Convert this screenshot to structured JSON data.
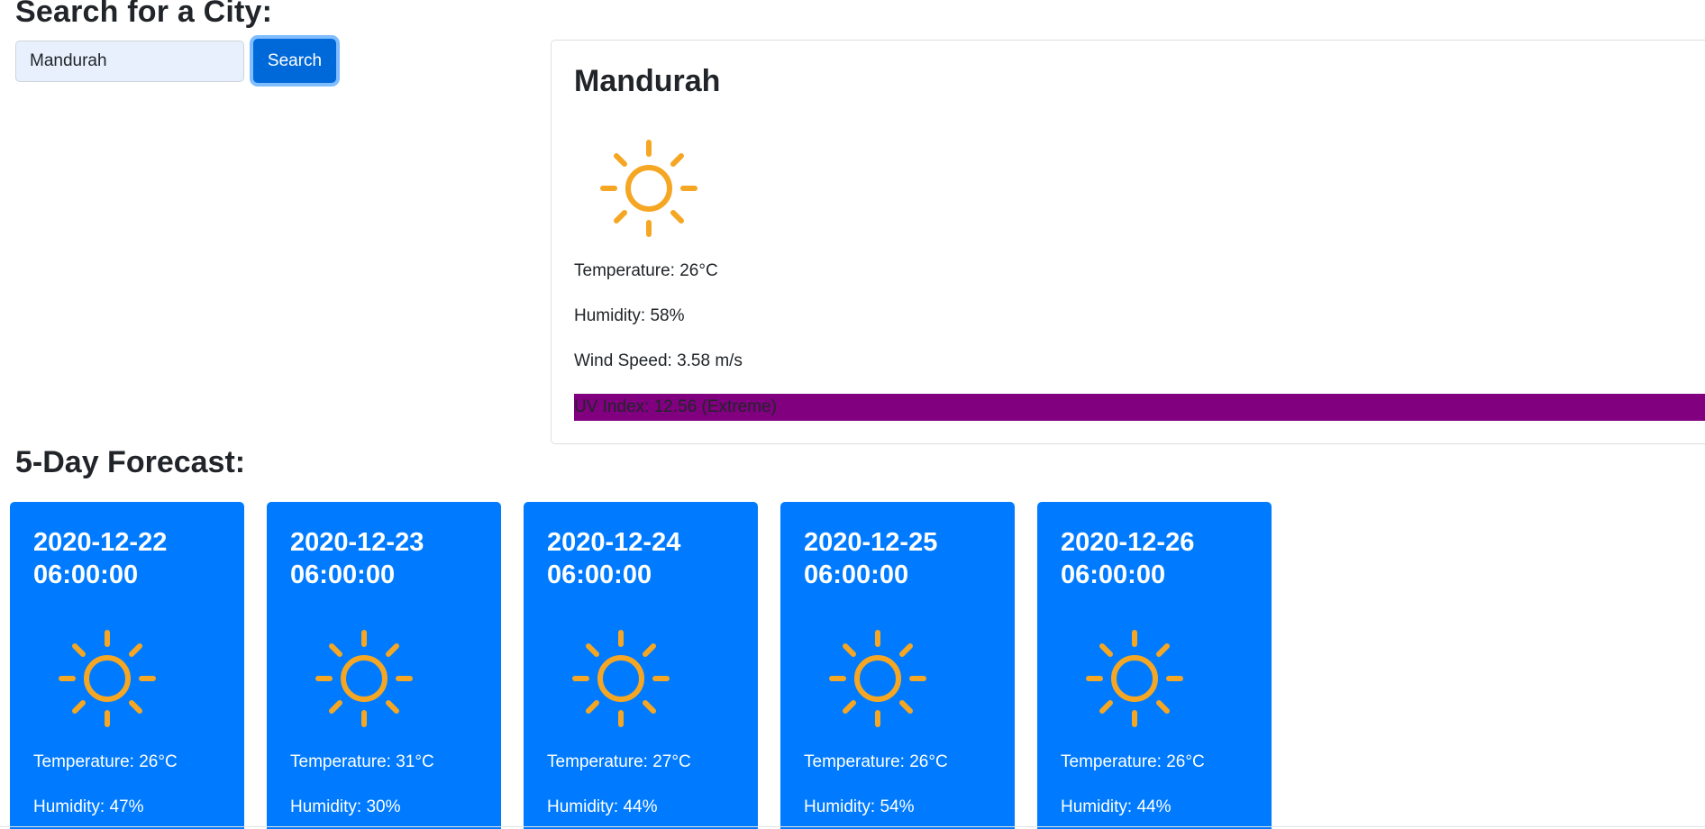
{
  "search": {
    "title": "Search for a City:",
    "input_value": "Mandurah",
    "button_label": "Search"
  },
  "current": {
    "city": "Mandurah",
    "icon": "sun-icon",
    "temperature": "Temperature: 26°C",
    "humidity": "Humidity: 58%",
    "wind": "Wind Speed: 3.58 m/s",
    "uv": "UV Index: 12.56 (Extreme)",
    "uv_color": "#800080"
  },
  "forecast": {
    "title": "5-Day Forecast:",
    "card_color": "#007bff",
    "icon_color": "#f5a623",
    "days": [
      {
        "date": "2020-12-22",
        "time": "06:00:00",
        "icon": "sun-icon",
        "temperature": "Temperature: 26°C",
        "humidity": "Humidity: 47%"
      },
      {
        "date": "2020-12-23",
        "time": "06:00:00",
        "icon": "sun-icon",
        "temperature": "Temperature: 31°C",
        "humidity": "Humidity: 30%"
      },
      {
        "date": "2020-12-24",
        "time": "06:00:00",
        "icon": "sun-icon",
        "temperature": "Temperature: 27°C",
        "humidity": "Humidity: 44%"
      },
      {
        "date": "2020-12-25",
        "time": "06:00:00",
        "icon": "sun-icon",
        "temperature": "Temperature: 26°C",
        "humidity": "Humidity: 54%"
      },
      {
        "date": "2020-12-26",
        "time": "06:00:00",
        "icon": "sun-icon",
        "temperature": "Temperature: 26°C",
        "humidity": "Humidity: 44%"
      }
    ]
  }
}
